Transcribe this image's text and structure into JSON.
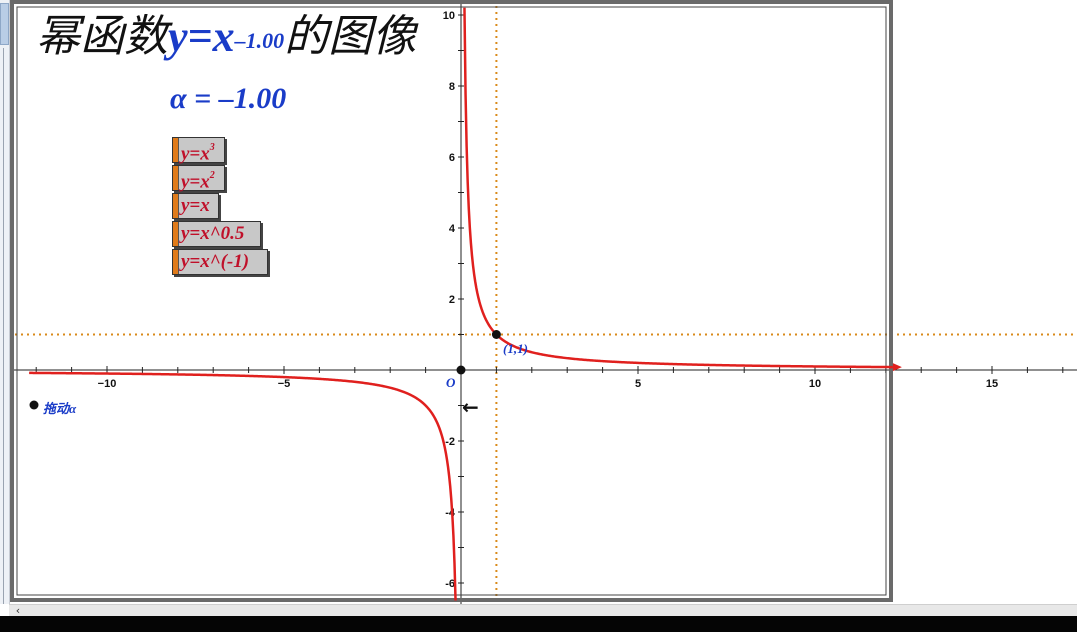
{
  "title": {
    "prefix": "幂函数",
    "fn_base": "y=x",
    "fn_exp": "–1.00",
    "suffix": "的图像"
  },
  "alpha_display": "α = –1.00",
  "buttons": [
    {
      "base": "y=x",
      "sup": "3"
    },
    {
      "base": "y=x",
      "sup": "2"
    },
    {
      "base": "y=x",
      "sup": ""
    },
    {
      "base": "y=x^0.5",
      "sup": ""
    },
    {
      "base": "y=x^(-1)",
      "sup": ""
    }
  ],
  "drag_label": "拖动α",
  "point_label": "(1,1)",
  "origin_label": "O",
  "arrow_icon": "arrow-left-icon",
  "colors": {
    "curve": "#e0201e",
    "dashed": "#d98a1a",
    "label_blue": "#1a3cc8",
    "button_text": "#c0102a",
    "button_stripe": "#e07b1a"
  },
  "chart_data": {
    "type": "line",
    "function": "y = x^alpha",
    "alpha": -1.0,
    "series": [
      {
        "x": [
          -12,
          -10,
          -8,
          -5,
          -3,
          -2,
          -1,
          -0.5,
          -0.3,
          -0.2,
          -0.16
        ],
        "y": [
          -0.083,
          -0.1,
          -0.125,
          -0.2,
          -0.333,
          -0.5,
          -1,
          -2,
          -3.33,
          -5,
          -6.25
        ]
      },
      {
        "x": [
          0.1,
          0.12,
          0.15,
          0.2,
          0.3,
          0.5,
          1,
          2,
          3,
          5,
          8,
          10,
          12
        ],
        "y": [
          10,
          8.33,
          6.67,
          5,
          3.33,
          2,
          1,
          0.5,
          0.333,
          0.2,
          0.125,
          0.1,
          0.083
        ]
      }
    ],
    "point": {
      "x": 1,
      "y": 1,
      "label": "(1,1)"
    },
    "guides": {
      "vertical_x": 1,
      "horizontal_y": 1
    },
    "xlim": [
      -12.3,
      17.5
    ],
    "ylim": [
      -6.5,
      10.2
    ],
    "x_ticks": [
      -10,
      -5,
      5,
      10,
      15
    ],
    "y_ticks": [
      -6,
      -4,
      -2,
      2,
      4,
      6,
      8,
      10
    ],
    "x_tick_labels": [
      "−10",
      "−5",
      "5",
      "10",
      "15"
    ],
    "y_tick_labels": [
      "-6",
      "-4",
      "-2",
      "2",
      "4",
      "6",
      "8",
      "10"
    ],
    "grid": false
  }
}
